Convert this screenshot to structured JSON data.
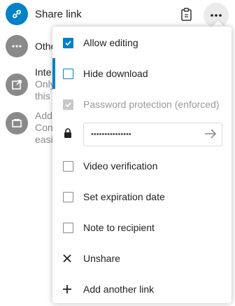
{
  "share_link": {
    "label": "Share link"
  },
  "rows": [
    {
      "title": "Othe",
      "sub": ""
    },
    {
      "title": "Inte",
      "sub": "Only",
      "sub2": "this"
    },
    {
      "title": "Add",
      "sub": "Con",
      "sub2": "easi"
    }
  ],
  "menu": {
    "allow_editing": {
      "label": "Allow editing",
      "checked": true
    },
    "hide_download": {
      "label": "Hide download",
      "checked": false
    },
    "password_protection": {
      "label": "Password protection (enforced)",
      "checked": true,
      "disabled": true
    },
    "password_value": "•••••••••••••••",
    "video_verification": {
      "label": "Video verification",
      "checked": false
    },
    "expiration": {
      "label": "Set expiration date",
      "checked": false
    },
    "note": {
      "label": "Note to recipient",
      "checked": false
    },
    "unshare": {
      "label": "Unshare"
    },
    "add_link": {
      "label": "Add another link"
    }
  },
  "colors": {
    "accent": "#0082c9",
    "grey_avatar": "#8a8a8a",
    "disabled_text": "#9a9a9a"
  },
  "icons": [
    "link-icon",
    "clipboard-icon",
    "more-icon",
    "ellipsis-icon",
    "external-icon",
    "add-icon",
    "lock-icon",
    "arrow-right-icon",
    "close-icon",
    "plus-icon"
  ]
}
